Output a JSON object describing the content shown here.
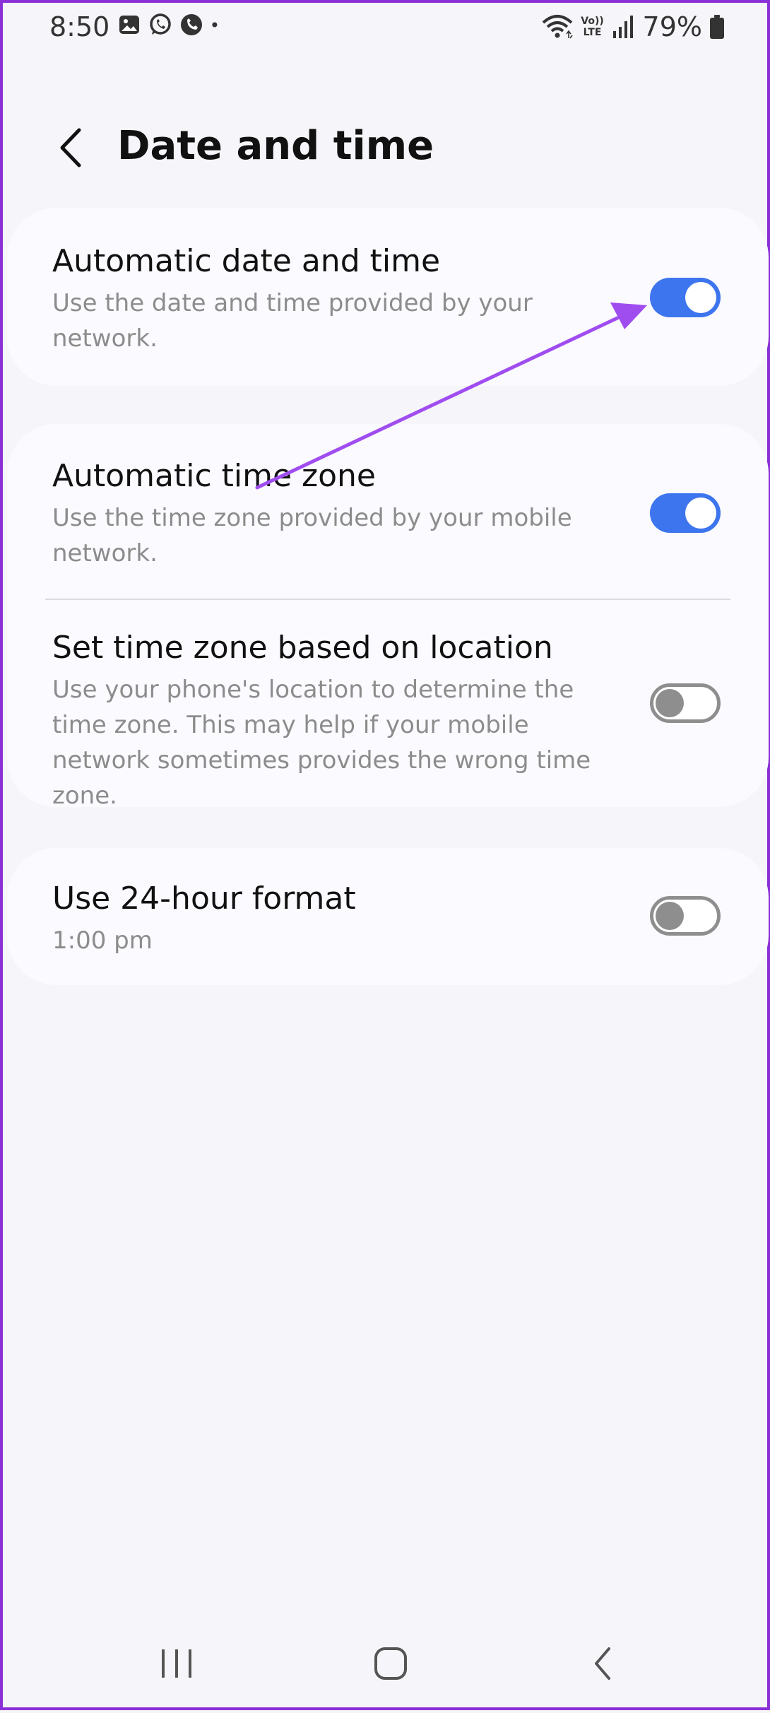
{
  "status_bar": {
    "time": "8:50",
    "left_icons": [
      "gallery-icon",
      "whatsapp-icon",
      "phone-call-icon",
      "dot-icon"
    ],
    "right_icons": [
      "wifi-icon",
      "volte-icon",
      "signal-icon",
      "battery-icon"
    ],
    "volte_label": "Vo)) LTE",
    "battery": "79%"
  },
  "header": {
    "back_icon": "chevron-left-icon",
    "title": "Date and time"
  },
  "settings": [
    {
      "title": "Automatic date and time",
      "description": "Use the date and time provided by your network.",
      "toggle": true
    },
    {
      "title": "Automatic time zone",
      "description": "Use the time zone provided by your mobile network.",
      "toggle": true
    },
    {
      "title": "Set time zone based on location",
      "description": "Use your phone's location to determine the time zone. This may help if your mobile network sometimes provides the wrong time zone.",
      "toggle": false
    },
    {
      "title": "Use 24-hour format",
      "description": "1:00 pm",
      "toggle": false
    }
  ],
  "nav_bar": {
    "icons": [
      "recent-apps-icon",
      "home-icon",
      "back-icon"
    ]
  },
  "colors": {
    "accent": "#3d75ee",
    "annotation_arrow": "#a04df0",
    "frame_border": "#8b2fd6",
    "background": "#f6f5f9"
  }
}
